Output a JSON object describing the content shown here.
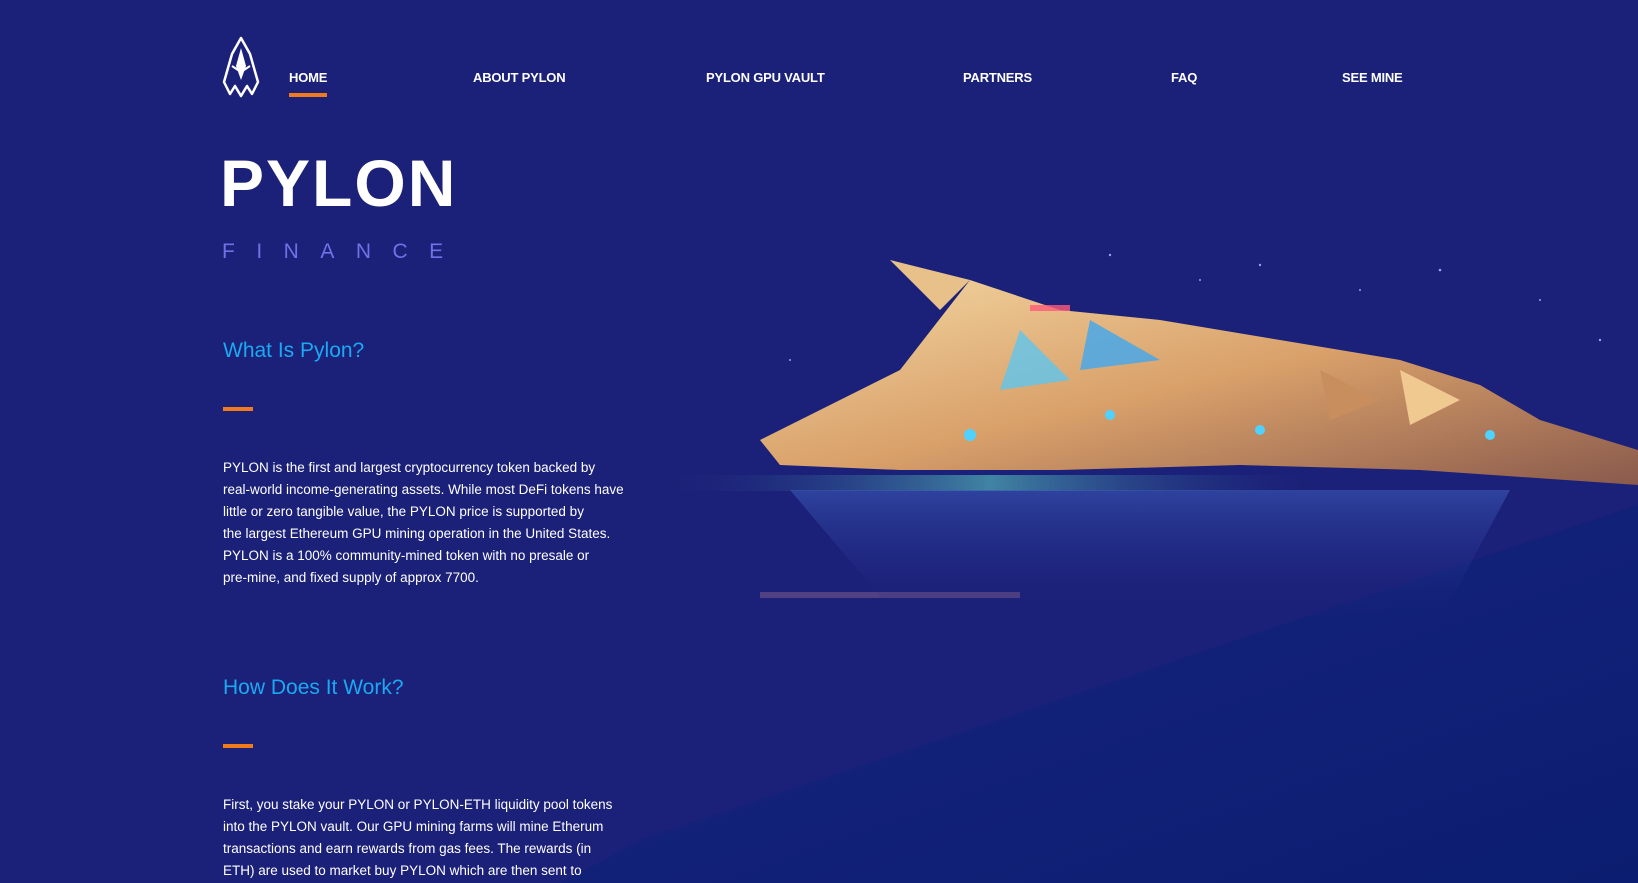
{
  "nav": {
    "items": [
      {
        "label": "HOME",
        "active": true
      },
      {
        "label": "ABOUT PYLON",
        "active": false
      },
      {
        "label": "PYLON GPU VAULT",
        "active": false
      },
      {
        "label": "PARTNERS",
        "active": false
      },
      {
        "label": "FAQ",
        "active": false
      },
      {
        "label": "SEE MINE",
        "active": false
      }
    ]
  },
  "brand": {
    "title": "PYLON",
    "subtitle": "FINANCE"
  },
  "sections": [
    {
      "title": "What Is Pylon?",
      "body": "PYLON is the first and largest cryptocurrency token backed by\nreal-world income-generating assets. While most DeFi tokens have\nlittle or zero tangible value, the PYLON price is supported by\nthe largest Ethereum GPU mining operation in the United States.\nPYLON is a 100% community-mined token with no presale or\npre-mine, and fixed supply of approx 7700."
    },
    {
      "title": "How Does It Work?",
      "body": "First, you stake your PYLON or PYLON-ETH liquidity pool tokens\ninto the PYLON vault. Our GPU mining farms will mine Etherum\ntransactions and earn rewards from gas fees. The rewards (in\nETH) are used to market buy PYLON which are then sent to"
    }
  ],
  "colors": {
    "background": "#1b2078",
    "accent": "#f07a1c",
    "heading": "#1aa9f2",
    "subtitle": "#6e72e6"
  },
  "icons": {
    "logo": "pylon-ship-logo-icon"
  }
}
